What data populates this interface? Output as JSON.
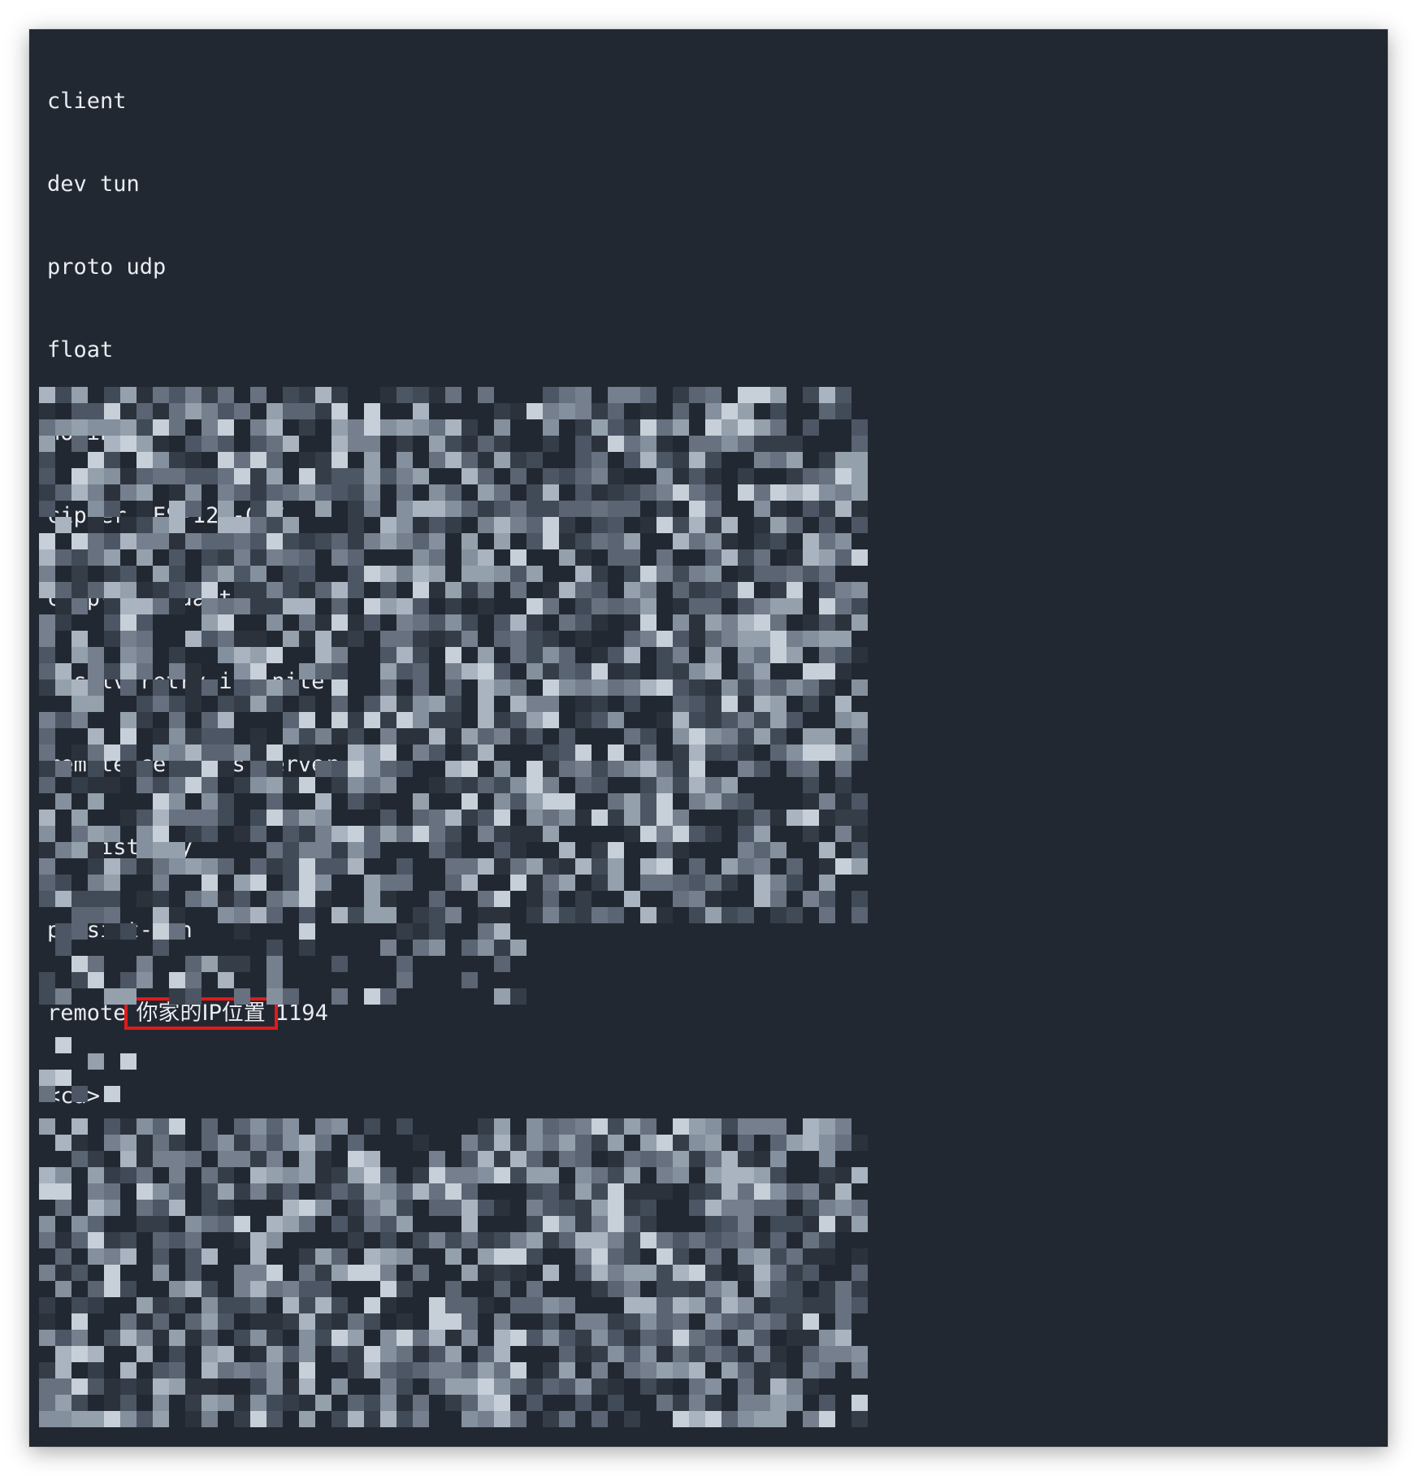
{
  "editor": {
    "lines": [
      {
        "text": "client"
      },
      {
        "text": "dev tun"
      },
      {
        "text": "proto udp"
      },
      {
        "text": "float"
      },
      {
        "text": "nobind"
      },
      {
        "text": "cipher AES-128-CBC"
      },
      {
        "text": "comp-lzo adaptive"
      },
      {
        "text": "resolv-retry infinite"
      },
      {
        "text": "remote-cert-tls server"
      },
      {
        "text": "persist-key"
      },
      {
        "text": "persist-tun"
      }
    ],
    "remote_line": {
      "keyword": "remote",
      "placeholder": "你家的IP位置",
      "port": "1194"
    },
    "ca_open_tag": "<ca>",
    "redaction": "pixelated"
  }
}
